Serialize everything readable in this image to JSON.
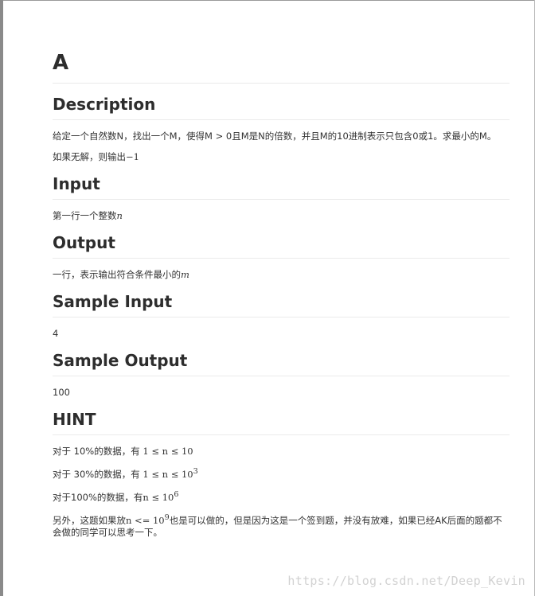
{
  "title": "A",
  "description": {
    "heading": "Description",
    "line1": "给定一个自然数N，找出一个M，使得M > 0且M是N的倍数，并且M的10进制表示只包含0或1。求最小的M。",
    "line2_text": "如果无解，则输出",
    "line2_math": "−1"
  },
  "input": {
    "heading": "Input",
    "text": "第一行一个整数",
    "math": "n"
  },
  "output": {
    "heading": "Output",
    "text": "一行，表示输出符合条件最小的",
    "math": "m"
  },
  "sample_input": {
    "heading": "Sample Input",
    "value": "4"
  },
  "sample_output": {
    "heading": "Sample Output",
    "value": "100"
  },
  "hint": {
    "heading": "HINT",
    "line1_prefix": "对于 10%的数据，有",
    "line1_math": "1 ≤ n ≤ 10",
    "line2_prefix": "对于 30%的数据，有",
    "line2_math": "1 ≤ n ≤ 10",
    "line2_exp": "3",
    "line3_prefix": "对于100%的数据，有",
    "line3_math": "n ≤ 10",
    "line3_exp": "6",
    "line4_a": "另外，这题如果放",
    "line4_math": "n <= 10",
    "line4_exp": "9",
    "line4_b": "也是可以做的，但是因为这是一个签到题，并没有放难，如果已经AK后面的题都不会做的同学可以思考一下。"
  },
  "watermark": "https://blog.csdn.net/Deep_Kevin"
}
